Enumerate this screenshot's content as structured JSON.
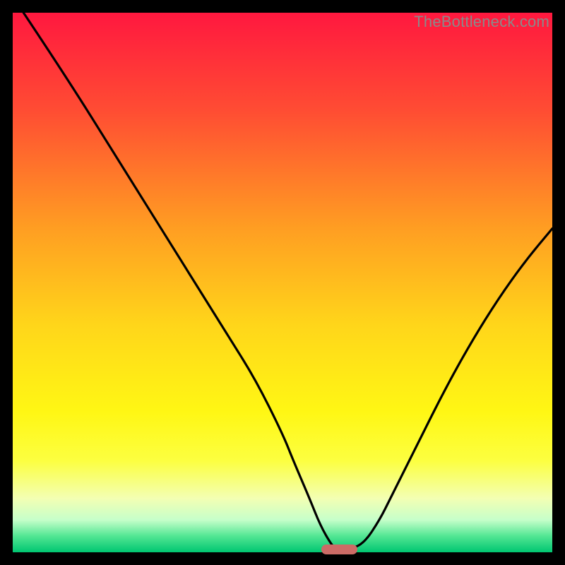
{
  "attribution": "TheBottleneck.com",
  "chart_data": {
    "type": "line",
    "title": "",
    "xlabel": "",
    "ylabel": "",
    "xlim": [
      0,
      100
    ],
    "ylim": [
      0,
      100
    ],
    "series": [
      {
        "name": "curve",
        "x": [
          2,
          10,
          20,
          30,
          35,
          40,
          45,
          50,
          52,
          55,
          57,
          59,
          60,
          62,
          65,
          68,
          70,
          75,
          80,
          85,
          90,
          95,
          100
        ],
        "y": [
          100,
          88,
          72,
          56,
          48,
          40,
          32,
          22,
          17,
          10,
          5,
          1.5,
          0.5,
          0.5,
          1.5,
          6,
          10,
          20,
          30,
          39,
          47,
          54,
          60
        ]
      }
    ],
    "marker": {
      "x_center": 60.5,
      "y": 0.5,
      "width_pct": 6.7
    },
    "gradient_stops": [
      {
        "offset": 0.0,
        "color": "#ff183f"
      },
      {
        "offset": 0.18,
        "color": "#ff4c33"
      },
      {
        "offset": 0.4,
        "color": "#ff9e22"
      },
      {
        "offset": 0.58,
        "color": "#ffd61a"
      },
      {
        "offset": 0.74,
        "color": "#fff714"
      },
      {
        "offset": 0.83,
        "color": "#fcff40"
      },
      {
        "offset": 0.9,
        "color": "#f3ffb3"
      },
      {
        "offset": 0.94,
        "color": "#c6ffca"
      },
      {
        "offset": 0.97,
        "color": "#52e693"
      },
      {
        "offset": 1.0,
        "color": "#00c671"
      }
    ],
    "colors": {
      "curve": "#000000",
      "marker": "#cc6b66",
      "background": "#000000"
    }
  }
}
